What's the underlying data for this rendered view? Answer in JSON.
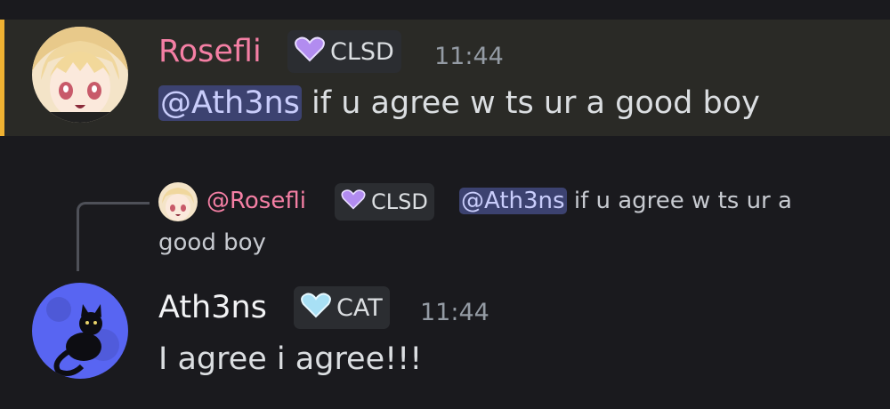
{
  "messages": [
    {
      "username": "Rosefli",
      "username_color": "#f47fa4",
      "tag": {
        "label": "CLSD",
        "icon": "purple-heart-icon",
        "color": "#b28cf0"
      },
      "timestamp": "11:44",
      "mention": "@Ath3ns",
      "text": " if u agree w ts ur a good boy",
      "highlighted": true,
      "highlight_bar_color": "#f0b232"
    },
    {
      "reply": {
        "username": "@Rosefli",
        "username_color": "#f47fa4",
        "tag": {
          "label": "CLSD",
          "icon": "purple-heart-icon"
        },
        "mention": "@Ath3ns",
        "text_line1": " if u agree w ts ur a",
        "text_line2": "good boy"
      },
      "username": "Ath3ns",
      "username_color": "#f2f3f5",
      "tag": {
        "label": "CAT",
        "icon": "light-blue-heart-icon",
        "color": "#a8e0f5"
      },
      "timestamp": "11:44",
      "text": "I agree i agree!!!"
    }
  ]
}
